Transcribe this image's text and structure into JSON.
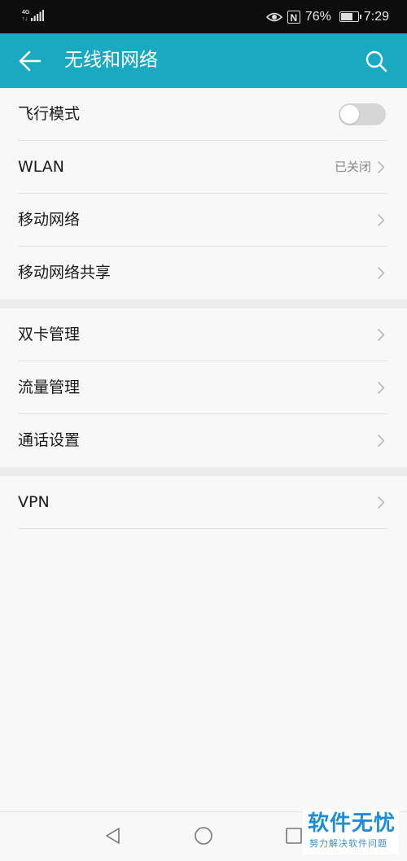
{
  "status_bar": {
    "network_type": "4G",
    "network_sub": "↑↓",
    "battery_percent": "76%",
    "battery_level": 0.76,
    "time": "7:29",
    "icons": [
      "signal-icon",
      "eye-icon",
      "nfc-icon",
      "battery-icon"
    ]
  },
  "app_bar": {
    "title": "无线和网络",
    "back_icon": "arrow-left-icon",
    "search_icon": "search-icon"
  },
  "sections": [
    {
      "items": [
        {
          "label": "飞行模式",
          "control": "toggle",
          "toggle_on": false
        },
        {
          "label": "WLAN",
          "value": "已关闭",
          "control": "chevron"
        },
        {
          "label": "移动网络",
          "control": "chevron"
        },
        {
          "label": "移动网络共享",
          "control": "chevron"
        }
      ]
    },
    {
      "items": [
        {
          "label": "双卡管理",
          "control": "chevron"
        },
        {
          "label": "流量管理",
          "control": "chevron"
        },
        {
          "label": "通话设置",
          "control": "chevron"
        }
      ]
    },
    {
      "items": [
        {
          "label": "VPN",
          "control": "chevron"
        }
      ]
    }
  ],
  "nav_bar": {
    "icons": [
      "nav-back-icon",
      "nav-home-icon",
      "nav-recent-icon"
    ]
  },
  "watermark": {
    "main": "软件无忧",
    "sub": "努力解决软件问题"
  },
  "colors": {
    "accent": "#19aac2",
    "status_bar": "#0d0d0d",
    "background": "#f8f8f8",
    "watermark": "#1d8ed6"
  }
}
